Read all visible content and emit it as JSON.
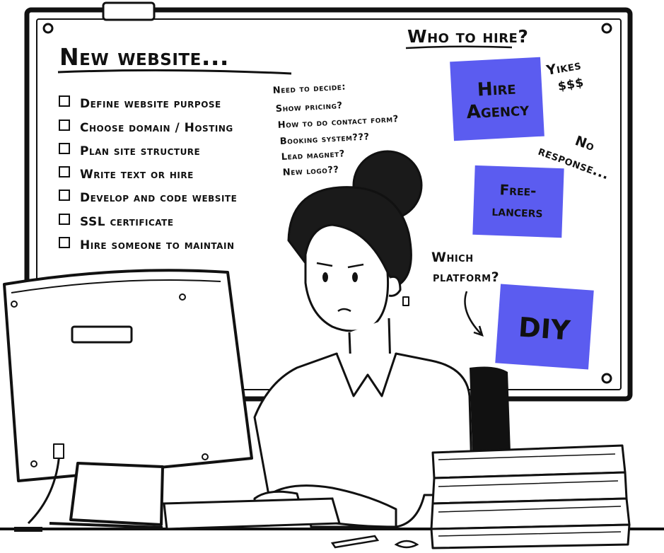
{
  "board": {
    "title": "New website...",
    "checklist": [
      "Define website purpose",
      "Choose domain / Hosting",
      "Plan site structure",
      "Write text or hire",
      "Develop and code website",
      "SSL certificate",
      "Hire someone to maintain"
    ],
    "decide": {
      "heading": "Need to decide:",
      "items": [
        "Show pricing?",
        "How to do contact form?",
        "Booking system???",
        "Lead magnet?",
        "New logo??"
      ]
    },
    "hire": {
      "heading": "Who to hire?",
      "notes": [
        {
          "line1": "Hire",
          "line2": "Agency"
        },
        {
          "line1": "Free-",
          "line2": "lancers"
        },
        {
          "line1": "DIY",
          "line2": ""
        }
      ],
      "yikes": "Yikes",
      "dollars": "$$$",
      "no_response_1": "No",
      "no_response_2": "response...",
      "which_1": "Which",
      "which_2": "platform?"
    },
    "note_color": "#5b5cf0"
  }
}
